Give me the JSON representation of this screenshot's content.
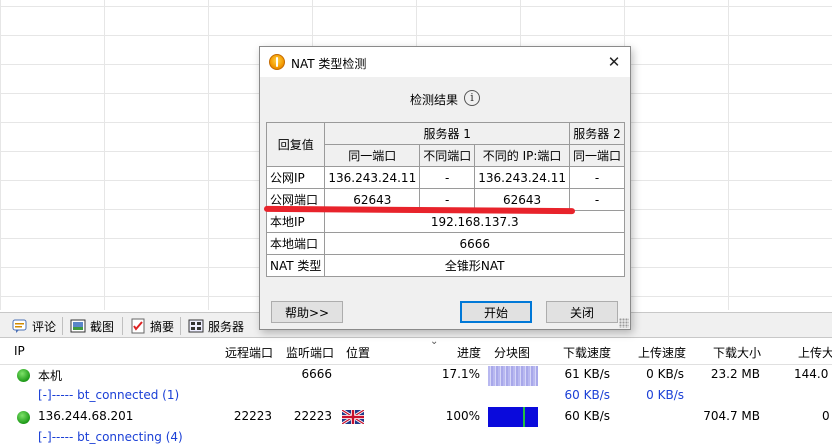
{
  "dialog": {
    "title": "NAT 类型检测",
    "result_label": "检测结果",
    "table": {
      "reply_header": "回复值",
      "server1_header": "服务器 1",
      "server2_header": "服务器 2",
      "sub_same_port": "同一端口",
      "sub_diff_port": "不同端口",
      "sub_diff_ip_port": "不同的 IP:端口",
      "sub_same_port_s2": "同一端口",
      "rows": {
        "public_ip": {
          "label": "公网IP",
          "same_port": "136.243.24.11",
          "diff_port": "-",
          "diff_ip_port": "136.243.24.11",
          "s2_same_port": "-"
        },
        "public_port": {
          "label": "公网端口",
          "same_port": "62643",
          "diff_port": "-",
          "diff_ip_port": "62643",
          "s2_same_port": "-"
        },
        "local_ip": {
          "label": "本地IP",
          "value": "192.168.137.3"
        },
        "local_port": {
          "label": "本地端口",
          "value": "6666"
        },
        "nat_type": {
          "label": "NAT 类型",
          "value": "全锥形NAT"
        }
      }
    },
    "buttons": {
      "help": "帮助>>",
      "start": "开始",
      "close": "关闭"
    }
  },
  "tabs": [
    "评论",
    "截图",
    "摘要",
    "服务器"
  ],
  "list": {
    "headers": {
      "ip": "IP",
      "remote_port": "远程端口",
      "listen_port": "监听端口",
      "location": "位置",
      "progress": "进度",
      "chunk_map": "分块图",
      "download_speed": "下载速度",
      "upload_speed": "上传速度",
      "download_size": "下载大小",
      "upload_size": "上传大"
    },
    "rows": [
      {
        "ip": "本机",
        "remote_port": "",
        "listen_port": "6666",
        "progress": "17.1%",
        "download_speed": "61 KB/s",
        "upload_speed": "0 KB/s",
        "download_size": "23.2 MB",
        "upload_size": "144.0"
      },
      {
        "ip": "[-]----- bt_connected (1)",
        "download_speed": "60 KB/s",
        "upload_speed": "0 KB/s"
      },
      {
        "ip": "136.244.68.201",
        "remote_port": "22223",
        "listen_port": "22223",
        "progress": "100%",
        "download_speed": "60 KB/s",
        "upload_speed": "",
        "download_size": "704.7 MB",
        "upload_size": "0"
      },
      {
        "ip": "[-]----- bt_connecting (4)"
      }
    ]
  }
}
